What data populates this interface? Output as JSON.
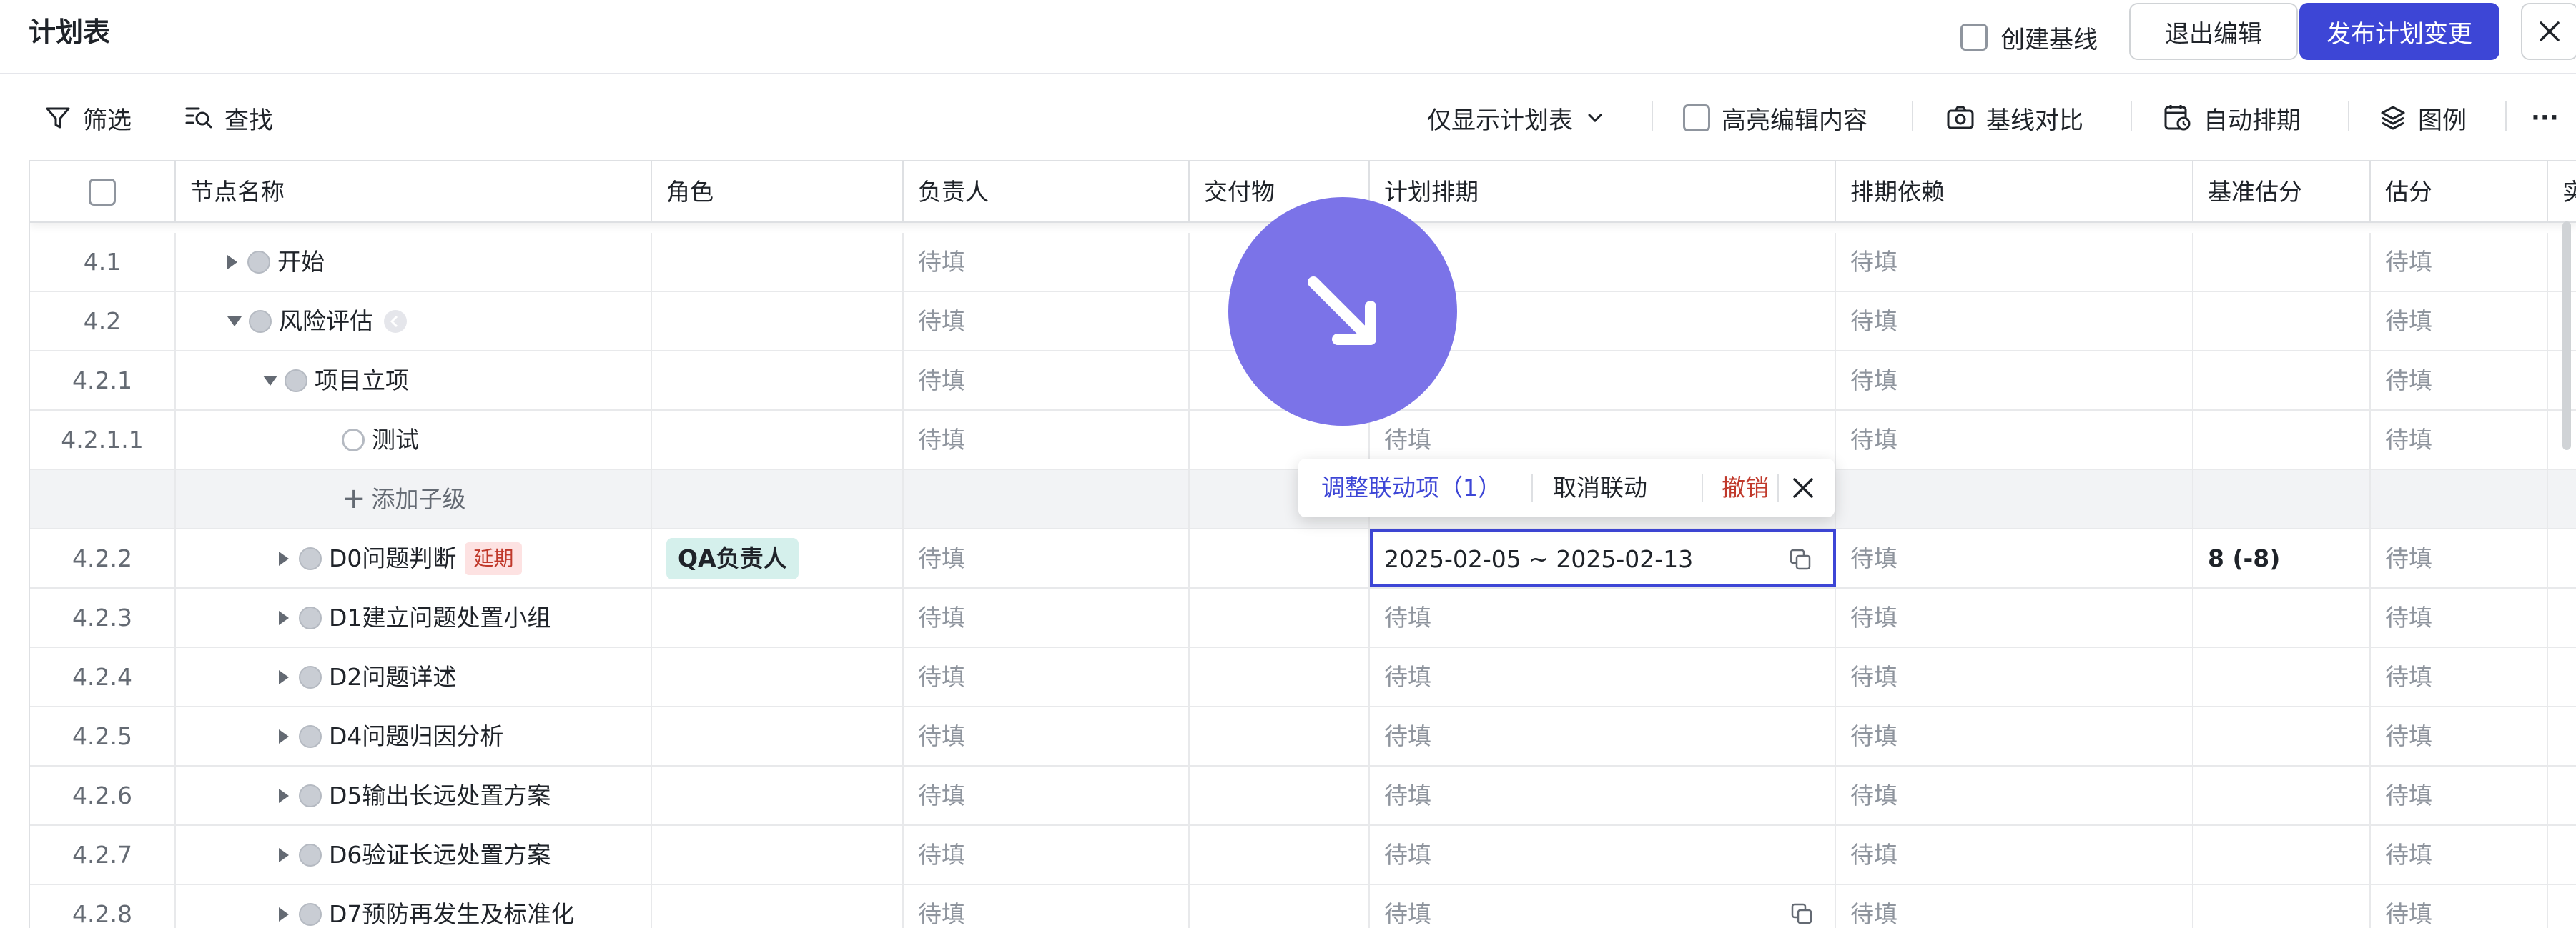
{
  "header": {
    "title": "计划表",
    "create_baseline_label": "创建基线",
    "exit_edit_label": "退出编辑",
    "publish_label": "发布计划变更"
  },
  "toolbar": {
    "filter_label": "筛选",
    "find_label": "查找",
    "view_select_value": "仅显示计划表",
    "highlight_label": "高亮编辑内容",
    "baseline_compare_label": "基线对比",
    "auto_schedule_label": "自动排期",
    "legend_label": "图例",
    "more_label": "···"
  },
  "table": {
    "columns": [
      "节点名称",
      "角色",
      "负责人",
      "交付物",
      "计划排期",
      "排期依赖",
      "基准估分",
      "估分",
      "实"
    ],
    "placeholder": "待填",
    "rows": [
      {
        "num": "4.1",
        "name": "开始",
        "role": "",
        "owner": "待填",
        "deliverable": "",
        "schedule": "",
        "dependency": "待填",
        "baseline": "",
        "estimate": "待填"
      },
      {
        "num": "4.2",
        "name": "风险评估",
        "role": "",
        "owner": "待填",
        "deliverable": "",
        "schedule": "",
        "dependency": "待填",
        "baseline": "",
        "estimate": "待填"
      },
      {
        "num": "4.2.1",
        "name": "项目立项",
        "role": "",
        "owner": "待填",
        "deliverable": "",
        "schedule": "",
        "dependency": "待填",
        "baseline": "",
        "estimate": "待填"
      },
      {
        "num": "4.2.1.1",
        "name": "测试",
        "role": "",
        "owner": "待填",
        "deliverable": "",
        "schedule": "待填",
        "dependency": "待填",
        "baseline": "",
        "estimate": "待填"
      },
      {
        "num": "",
        "name": "添加子级",
        "role": "",
        "owner": "",
        "deliverable": "",
        "schedule": "",
        "dependency": "",
        "baseline": "",
        "estimate": ""
      },
      {
        "num": "4.2.2",
        "name": "D0问题判断",
        "tag": "延期",
        "role": "QA负责人",
        "owner": "待填",
        "deliverable": "",
        "schedule": "2025-02-05 ~ 2025-02-13",
        "dependency": "待填",
        "baseline": "8 (-8)",
        "estimate": "待填"
      },
      {
        "num": "4.2.3",
        "name": "D1建立问题处置小组",
        "role": "",
        "owner": "待填",
        "deliverable": "",
        "schedule": "待填",
        "dependency": "待填",
        "baseline": "",
        "estimate": "待填"
      },
      {
        "num": "4.2.4",
        "name": "D2问题详述",
        "role": "",
        "owner": "待填",
        "deliverable": "",
        "schedule": "待填",
        "dependency": "待填",
        "baseline": "",
        "estimate": "待填"
      },
      {
        "num": "4.2.5",
        "name": "D4问题归因分析",
        "role": "",
        "owner": "待填",
        "deliverable": "",
        "schedule": "待填",
        "dependency": "待填",
        "baseline": "",
        "estimate": "待填"
      },
      {
        "num": "4.2.6",
        "name": "D5输出长远处置方案",
        "role": "",
        "owner": "待填",
        "deliverable": "",
        "schedule": "待填",
        "dependency": "待填",
        "baseline": "",
        "estimate": "待填"
      },
      {
        "num": "4.2.7",
        "name": "D6验证长远处置方案",
        "role": "",
        "owner": "待填",
        "deliverable": "",
        "schedule": "待填",
        "dependency": "待填",
        "baseline": "",
        "estimate": "待填"
      },
      {
        "num": "4.2.8",
        "name": "D7预防再发生及标准化",
        "role": "",
        "owner": "待填",
        "deliverable": "",
        "schedule": "待填",
        "dependency": "待填",
        "baseline": "",
        "estimate": "待填"
      }
    ]
  },
  "popup": {
    "adjust_label": "调整联动项（1）",
    "cancel_link_label": "取消联动",
    "undo_label": "撤销"
  },
  "colors": {
    "accent": "#3d46d6",
    "cursor": "#7b73e8",
    "delay_tag_bg": "#fde2e2",
    "role_chip_bg": "#d5f0ec",
    "undo": "#c0392b"
  }
}
